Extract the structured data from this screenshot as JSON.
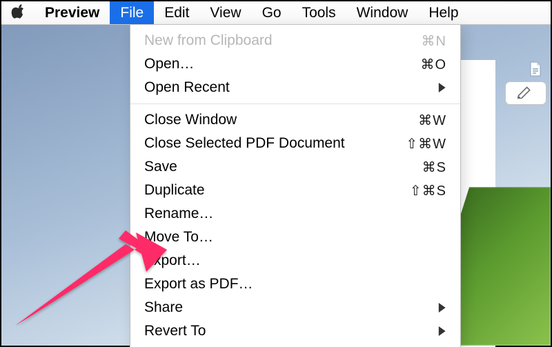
{
  "menubar": {
    "app": "Preview",
    "items": [
      "File",
      "Edit",
      "View",
      "Go",
      "Tools",
      "Window",
      "Help"
    ],
    "active_index": 0
  },
  "file_menu": {
    "new_from_clipboard": {
      "label": "New from Clipboard",
      "shortcut": "⌘N"
    },
    "open": {
      "label": "Open…",
      "shortcut": "⌘O"
    },
    "open_recent": {
      "label": "Open Recent"
    },
    "close_window": {
      "label": "Close Window",
      "shortcut": "⌘W"
    },
    "close_selected": {
      "label": "Close Selected PDF Document",
      "shortcut": "⇧⌘W"
    },
    "save": {
      "label": "Save",
      "shortcut": "⌘S"
    },
    "duplicate": {
      "label": "Duplicate",
      "shortcut": "⇧⌘S"
    },
    "rename": {
      "label": "Rename…"
    },
    "move_to": {
      "label": "Move To…"
    },
    "export": {
      "label": "Export…"
    },
    "export_pdf": {
      "label": "Export as PDF…"
    },
    "share": {
      "label": "Share"
    },
    "revert_to": {
      "label": "Revert To"
    }
  },
  "icons": {
    "apple": "apple-icon",
    "markup": "markup-icon",
    "page": "page-icon"
  },
  "annotation": {
    "color": "#ff2a68"
  }
}
